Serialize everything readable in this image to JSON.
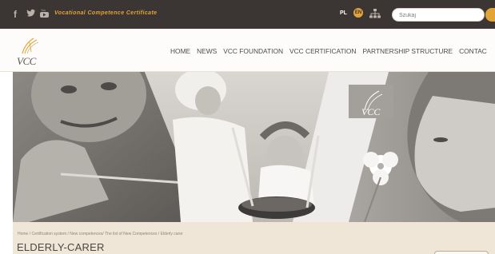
{
  "topbar": {
    "social": [
      "facebook-icon",
      "twitter-icon",
      "youtube-icon"
    ],
    "social_glyphs": {
      "facebook": "f",
      "twitter": "🐦",
      "youtube": "▶"
    },
    "tagline": "Vocational Competence Certificate",
    "lang_pl": "PL",
    "lang_en": "EN",
    "search_placeholder": "Szukaj",
    "colors": {
      "bar": "#3b3633",
      "accent": "#e3a437"
    }
  },
  "header": {
    "logo_text": "VCC",
    "nav": [
      "HOME",
      "NEWS",
      "VCC FOUNDATION",
      "VCC CERTIFICATION",
      "PARTNERSHIP STRUCTURE",
      "CONTAC"
    ]
  },
  "hero": {
    "badge_text": "VCC"
  },
  "page": {
    "breadcrumb": "Home / Certification system / New competences/ The list of New Competences / Elderly carer",
    "title": "ELDERLY-CARER"
  }
}
